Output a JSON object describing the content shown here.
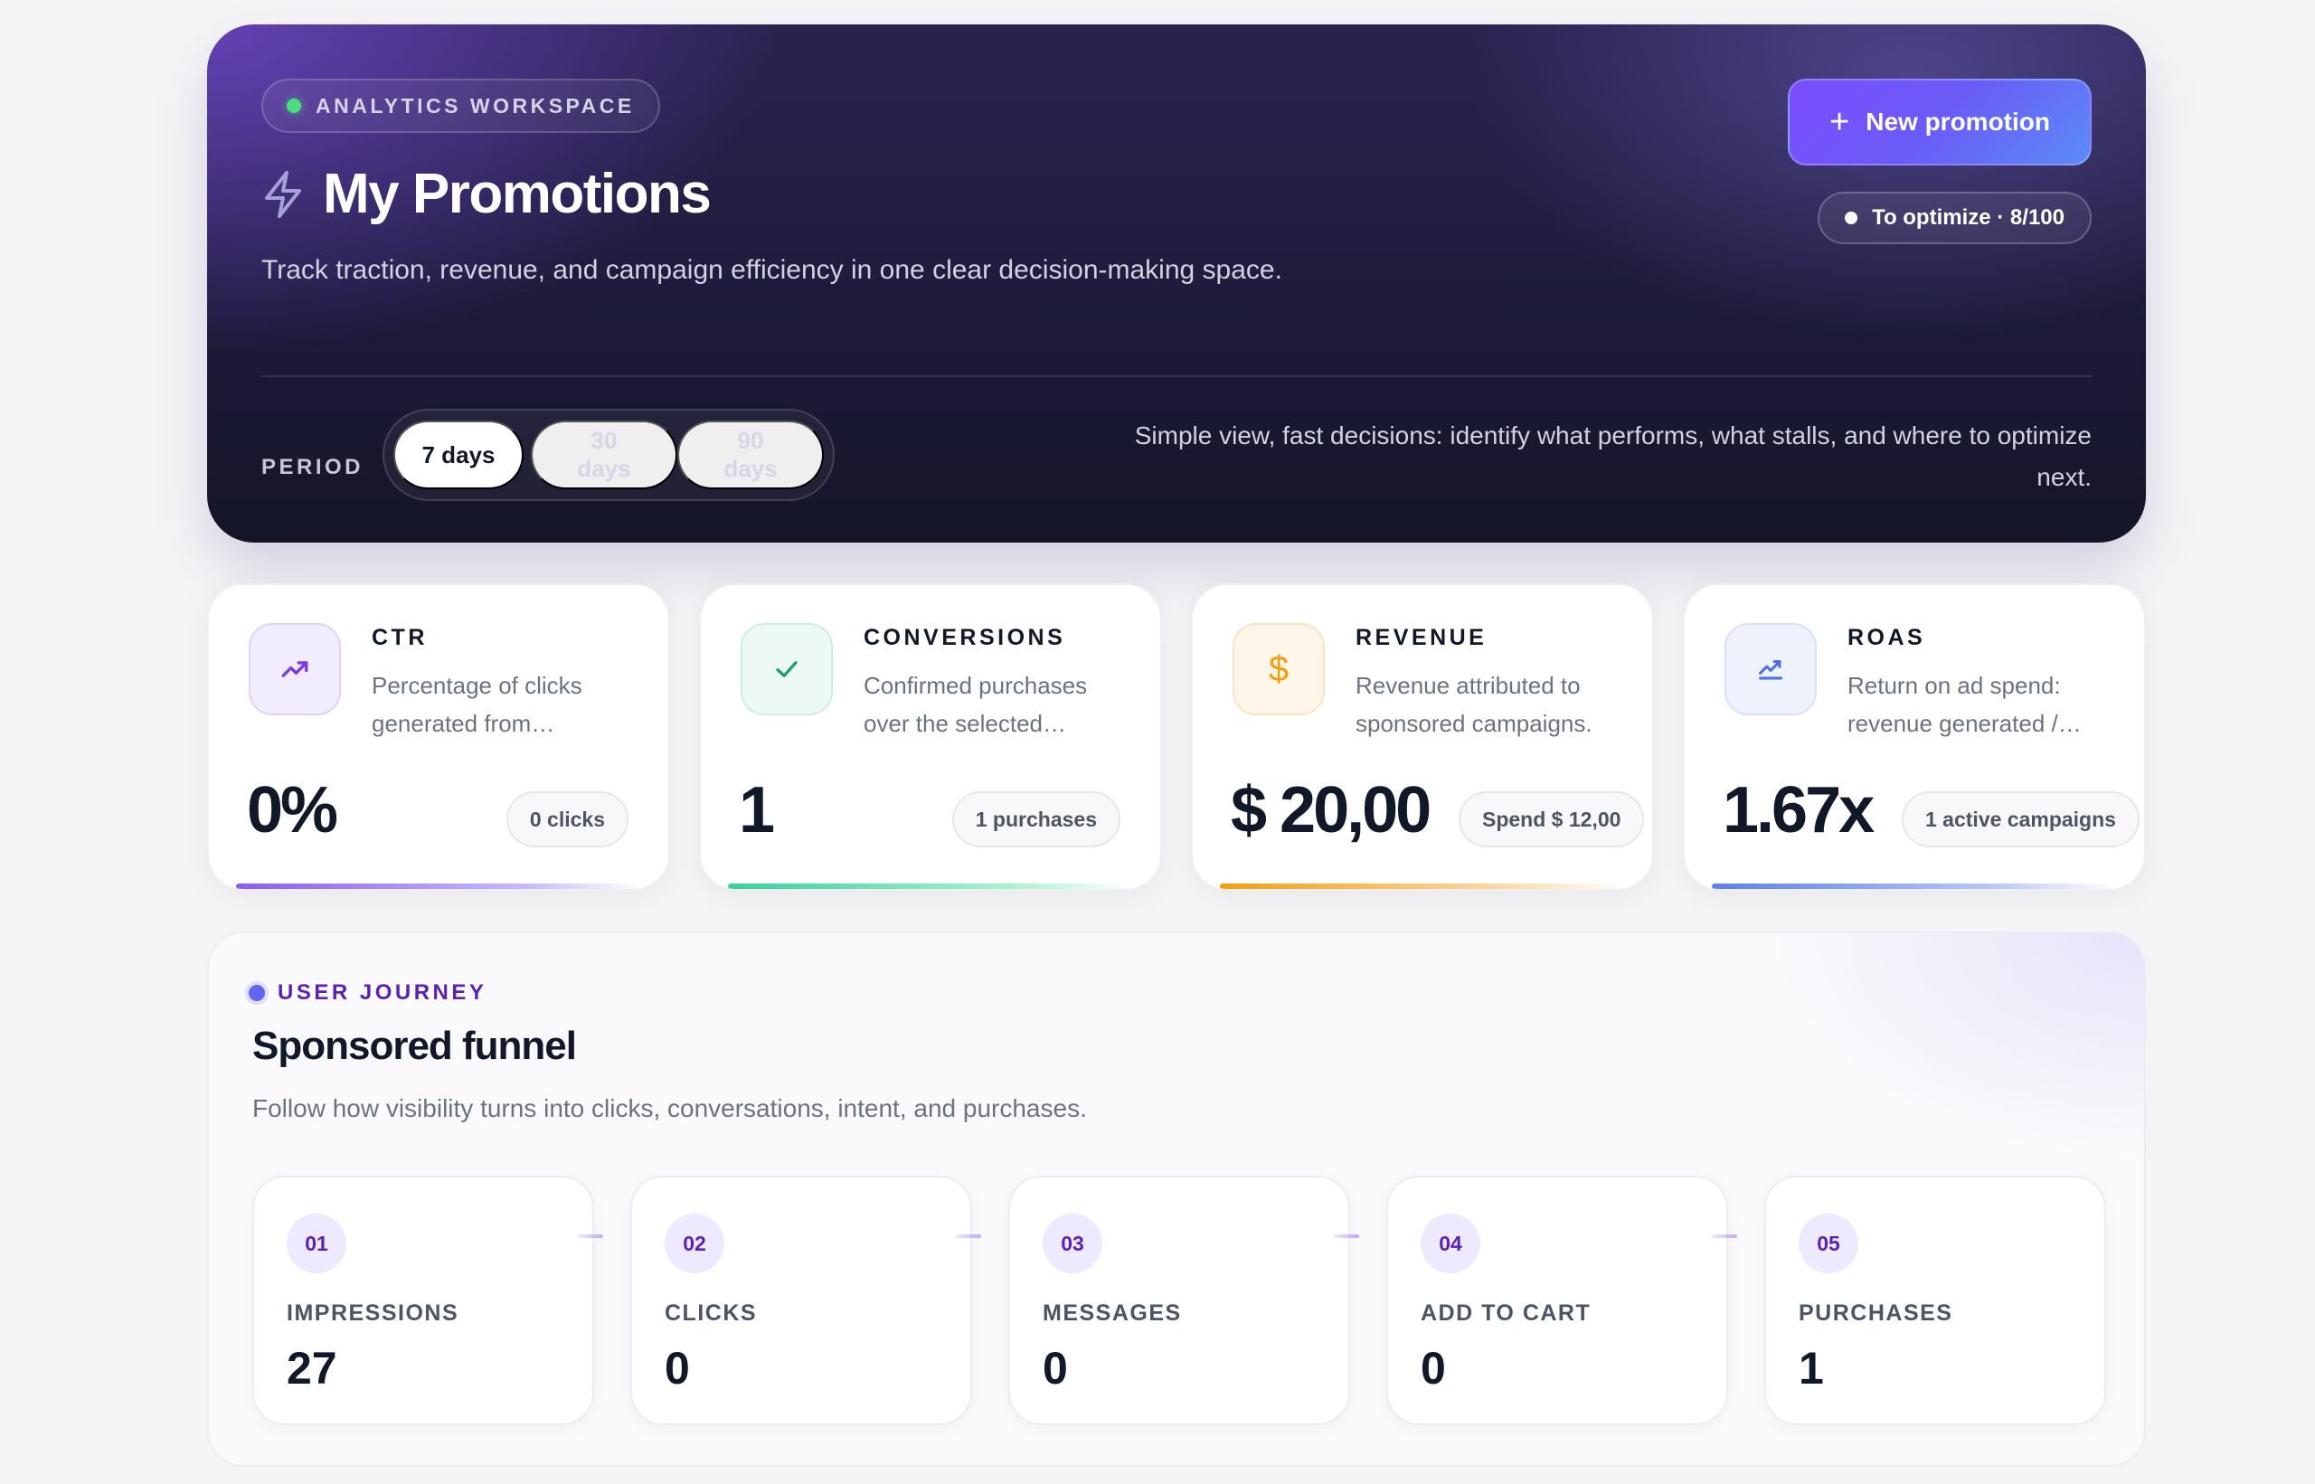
{
  "hero": {
    "badge_label": "ANALYTICS WORKSPACE",
    "title": "My Promotions",
    "subtitle": "Track traction, revenue, and campaign efficiency in one clear decision-making space.",
    "new_button_label": "New promotion",
    "optimize_label": "To optimize · 8/100",
    "period_label": "PERIOD",
    "periods": [
      "7 days",
      "30 days",
      "90 days"
    ],
    "selected_period": "7 days",
    "note": "Simple view, fast decisions: identify what performs, what stalls, and where to optimize next."
  },
  "kpis": [
    {
      "title": "CTR",
      "description": "Percentage of clicks generated from…",
      "value": "0%",
      "chip": "0 clicks",
      "icon": "trending-up-icon",
      "accent": "#8b5cf6"
    },
    {
      "title": "CONVERSIONS",
      "description": "Confirmed purchases over the selected…",
      "value": "1",
      "chip": "1 purchases",
      "icon": "check-icon",
      "accent": "#34d399"
    },
    {
      "title": "REVENUE",
      "description": "Revenue attributed to sponsored campaigns.",
      "value": "$ 20,00",
      "chip": "Spend $ 12,00",
      "icon": "dollar-icon",
      "accent": "#f59e0b"
    },
    {
      "title": "ROAS",
      "description": "Return on ad spend: revenue generated /…",
      "value": "1.67x",
      "chip": "1 active campaigns",
      "icon": "chart-line-icon",
      "accent": "#5b7ff0"
    }
  ],
  "funnel": {
    "label": "USER JOURNEY",
    "title": "Sponsored funnel",
    "subtitle": "Follow how visibility turns into clicks, conversations, intent, and purchases.",
    "steps": [
      {
        "num": "01",
        "label": "IMPRESSIONS",
        "value": "27"
      },
      {
        "num": "02",
        "label": "CLICKS",
        "value": "0"
      },
      {
        "num": "03",
        "label": "MESSAGES",
        "value": "0"
      },
      {
        "num": "04",
        "label": "ADD TO CART",
        "value": "0"
      },
      {
        "num": "05",
        "label": "PURCHASES",
        "value": "1"
      }
    ]
  }
}
